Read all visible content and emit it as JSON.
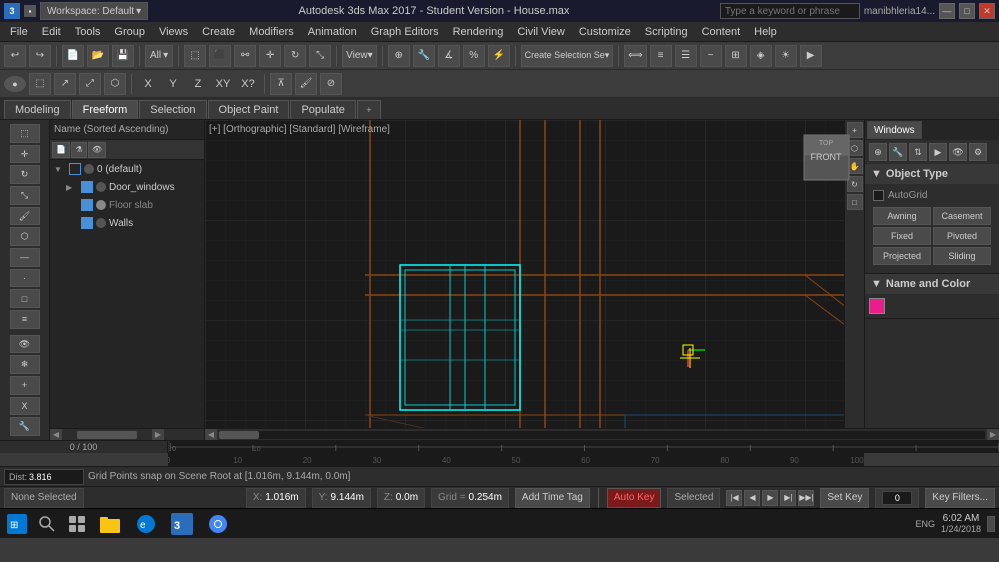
{
  "titlebar": {
    "app_name": "3DS MAX",
    "workspace": "Workspace: Default",
    "title": "Autodesk 3ds Max 2017 - Student Version - House.max",
    "search_placeholder": "Type a keyword or phrase",
    "user": "manibhleria14...",
    "controls": [
      "—",
      "□",
      "✕"
    ]
  },
  "menubar": {
    "items": [
      "File",
      "Edit",
      "Tools",
      "Group",
      "Views",
      "Create",
      "Modifiers",
      "Animation",
      "Graph Editors",
      "Rendering",
      "Civil View",
      "Customize",
      "Scripting",
      "Content",
      "Help"
    ]
  },
  "toolbar1": {
    "undo_label": "↩",
    "redo_label": "↪",
    "filter_label": "All",
    "create_selection_label": "Create Selection Se▾"
  },
  "toolbar2": {
    "x_label": "X",
    "y_label": "Y",
    "z_label": "Z",
    "xy_label": "XY",
    "xy2_label": "X?"
  },
  "tabs": {
    "items": [
      {
        "label": "Modeling",
        "active": false
      },
      {
        "label": "Freeform",
        "active": true
      },
      {
        "label": "Selection",
        "active": false
      },
      {
        "label": "Object Paint",
        "active": false
      },
      {
        "label": "Populate",
        "active": false
      }
    ],
    "close_label": "×"
  },
  "scene_explorer": {
    "header": "Name (Sorted Ascending)",
    "items": [
      {
        "label": "0 (default)",
        "type": "layer",
        "expanded": true,
        "indent": 0
      },
      {
        "label": "Door_windows",
        "type": "object",
        "expanded": false,
        "indent": 1
      },
      {
        "label": "Floor slab",
        "type": "object",
        "expanded": false,
        "indent": 1
      },
      {
        "label": "Walls",
        "type": "object",
        "expanded": false,
        "indent": 1
      }
    ]
  },
  "viewport": {
    "label": "[+] [Orthographic] [Standard] [Wireframe]",
    "cube_label": "FRONT",
    "grid_spacing": "0.254m"
  },
  "right_panel": {
    "tab": "Windows",
    "object_type_header": "Object Type",
    "autogrid_label": "AutoGrid",
    "type_buttons": [
      {
        "label": "Awning",
        "row": 0,
        "col": 0
      },
      {
        "label": "Casement",
        "row": 0,
        "col": 1
      },
      {
        "label": "Fixed",
        "row": 1,
        "col": 0
      },
      {
        "label": "Pivoted",
        "row": 1,
        "col": 1
      },
      {
        "label": "Projected",
        "row": 2,
        "col": 0
      },
      {
        "label": "Sliding",
        "row": 2,
        "col": 1
      }
    ],
    "name_color_header": "Name and Color",
    "swatch_color": "#e91e8c"
  },
  "timeline": {
    "start": "0",
    "end": "100",
    "current": "0 / 100",
    "ticks": [
      0,
      10,
      20,
      30,
      40,
      50,
      60,
      70,
      80,
      90,
      100
    ]
  },
  "statusbar": {
    "status_text": "None Selected",
    "x_label": "X:",
    "x_val": "1.016m",
    "y_label": "Y:",
    "y_val": "9.144m",
    "z_label": "Z:",
    "z_val": "0.0m",
    "grid_label": "Grid =",
    "grid_val": "0.254m",
    "add_time_label": "Add Time Tag",
    "mode_label": "Auto Key",
    "selected_label": "Selected",
    "set_key_label": "Set Key",
    "key_filters_label": "Key Filters...",
    "snap_info": "Grid Points snap on Scene Root at [1.016m, 9.144m, 0.0m]"
  },
  "taskbar": {
    "time": "6:02 AM",
    "date": "1/24/2018",
    "lang": "ENG"
  },
  "coord_display": {
    "dist_label": "Dist:",
    "dist_val": "3.816"
  }
}
